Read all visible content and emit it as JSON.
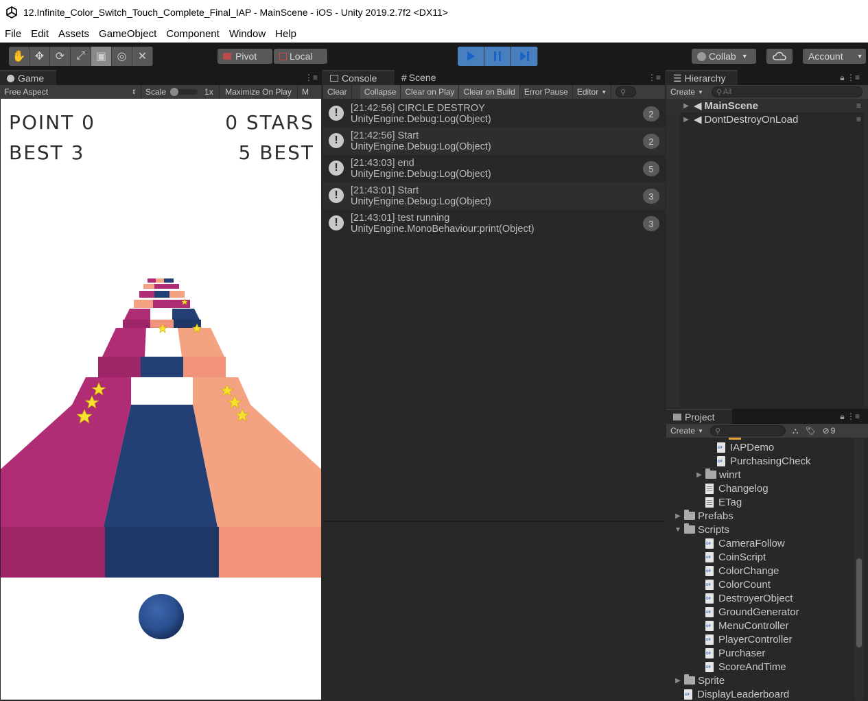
{
  "window": {
    "title": "12.Infinite_Color_Switch_Touch_Complete_Final_IAP - MainScene - iOS - Unity 2019.2.7f2 <DX11>"
  },
  "menu": [
    "File",
    "Edit",
    "Assets",
    "GameObject",
    "Component",
    "Window",
    "Help"
  ],
  "toolbar": {
    "tools": [
      "hand-tool-icon",
      "move-tool-icon",
      "rotate-tool-icon",
      "scale-tool-icon",
      "rect-tool-icon",
      "transform-tool-icon",
      "custom-tool-icon"
    ],
    "active_tool": "rect-tool-icon",
    "pivot_label": "Pivot",
    "local_label": "Local",
    "collab_label": "Collab",
    "account_label": "Account"
  },
  "game": {
    "tab_label": "Game",
    "aspect_label": "Free Aspect",
    "scale_label": "Scale",
    "scale_value": "1x",
    "maximize_label": "Maximize On Play",
    "mute_label": "M",
    "hud": {
      "point": "POINT 0",
      "stars": "0 STARS",
      "best_left": "BEST 3",
      "best_right": "5 BEST"
    },
    "colors": {
      "magenta": "#b02c74",
      "navy": "#243f73",
      "salmon": "#f3a282",
      "white": "#ffffff",
      "star": "#f5e12e",
      "ball": "#2b4f8f"
    }
  },
  "console": {
    "tab_label": "Console",
    "scene_tab_label": "Scene",
    "buttons": [
      "Clear",
      "Collapse",
      "Clear on Play",
      "Clear on Build",
      "Error Pause",
      "Editor"
    ],
    "active_buttons": [
      "Collapse",
      "Clear on Play",
      "Clear on Build"
    ],
    "logs": [
      {
        "line1": "[21:42:56] CIRCLE DESTROY",
        "line2": "UnityEngine.Debug:Log(Object)",
        "count": "2"
      },
      {
        "line1": "[21:42:56] Start",
        "line2": "UnityEngine.Debug:Log(Object)",
        "count": "2"
      },
      {
        "line1": "[21:43:03] end",
        "line2": "UnityEngine.Debug:Log(Object)",
        "count": "5"
      },
      {
        "line1": "[21:43:01] Start",
        "line2": "UnityEngine.Debug:Log(Object)",
        "count": "3"
      },
      {
        "line1": "[21:43:01] test running",
        "line2": "UnityEngine.MonoBehaviour:print(Object)",
        "count": "3"
      }
    ]
  },
  "hierarchy": {
    "tab_label": "Hierarchy",
    "create_label": "Create",
    "search_placeholder": "All",
    "items": [
      "MainScene",
      "DontDestroyOnLoad"
    ]
  },
  "project": {
    "tab_label": "Project",
    "create_label": "Create",
    "hidden_count": "9",
    "items": [
      {
        "label": "IAPDemo",
        "type": "cs",
        "indent": 3,
        "arrow": ""
      },
      {
        "label": "PurchasingCheck",
        "type": "cs",
        "indent": 3,
        "arrow": ""
      },
      {
        "label": "winrt",
        "type": "folder",
        "indent": 2,
        "arrow": "collapsed"
      },
      {
        "label": "Changelog",
        "type": "txt",
        "indent": 2,
        "arrow": ""
      },
      {
        "label": "ETag",
        "type": "txt",
        "indent": 2,
        "arrow": ""
      },
      {
        "label": "Prefabs",
        "type": "folder",
        "indent": 0,
        "arrow": "collapsed"
      },
      {
        "label": "Scripts",
        "type": "folder",
        "indent": 0,
        "arrow": "expanded"
      },
      {
        "label": "CameraFollow",
        "type": "cs",
        "indent": 1,
        "arrow": ""
      },
      {
        "label": "CoinScript",
        "type": "cs",
        "indent": 1,
        "arrow": ""
      },
      {
        "label": "ColorChange",
        "type": "cs",
        "indent": 1,
        "arrow": ""
      },
      {
        "label": "ColorCount",
        "type": "cs",
        "indent": 1,
        "arrow": ""
      },
      {
        "label": "DestroyerObject",
        "type": "cs",
        "indent": 1,
        "arrow": ""
      },
      {
        "label": "GroundGenerator",
        "type": "cs",
        "indent": 1,
        "arrow": ""
      },
      {
        "label": "MenuController",
        "type": "cs",
        "indent": 1,
        "arrow": ""
      },
      {
        "label": "PlayerController",
        "type": "cs",
        "indent": 1,
        "arrow": ""
      },
      {
        "label": "Purchaser",
        "type": "cs",
        "indent": 1,
        "arrow": ""
      },
      {
        "label": "ScoreAndTime",
        "type": "cs",
        "indent": 1,
        "arrow": ""
      },
      {
        "label": "Sprite",
        "type": "folder",
        "indent": 0,
        "arrow": "collapsed"
      },
      {
        "label": "DisplayLeaderboard",
        "type": "cs",
        "indent": 0,
        "arrow": ""
      }
    ]
  }
}
